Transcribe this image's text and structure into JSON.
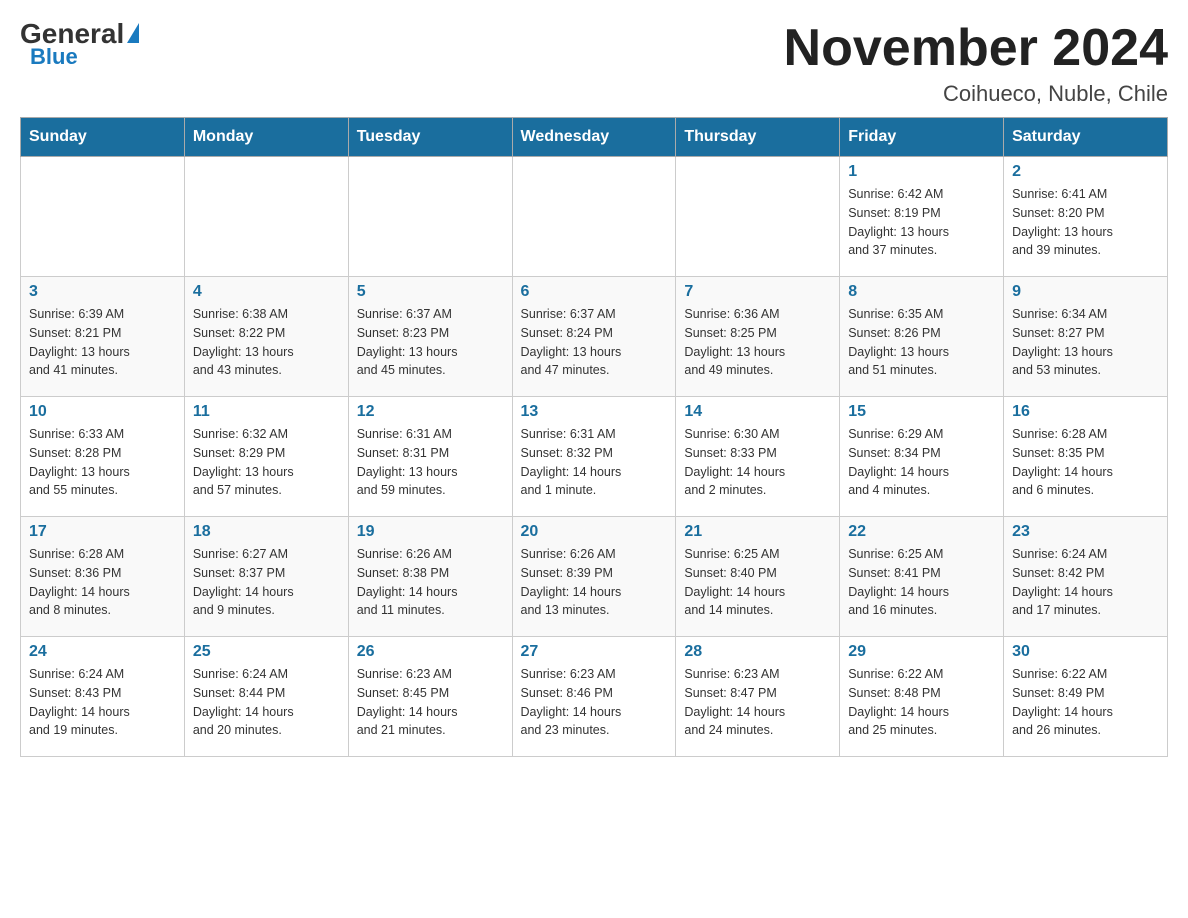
{
  "logo": {
    "general": "General",
    "blue": "Blue",
    "triangle_unicode": "▶"
  },
  "title": "November 2024",
  "location": "Coihueco, Nuble, Chile",
  "weekdays": [
    "Sunday",
    "Monday",
    "Tuesday",
    "Wednesday",
    "Thursday",
    "Friday",
    "Saturday"
  ],
  "weeks": [
    [
      {
        "day": "",
        "info": ""
      },
      {
        "day": "",
        "info": ""
      },
      {
        "day": "",
        "info": ""
      },
      {
        "day": "",
        "info": ""
      },
      {
        "day": "",
        "info": ""
      },
      {
        "day": "1",
        "info": "Sunrise: 6:42 AM\nSunset: 8:19 PM\nDaylight: 13 hours\nand 37 minutes."
      },
      {
        "day": "2",
        "info": "Sunrise: 6:41 AM\nSunset: 8:20 PM\nDaylight: 13 hours\nand 39 minutes."
      }
    ],
    [
      {
        "day": "3",
        "info": "Sunrise: 6:39 AM\nSunset: 8:21 PM\nDaylight: 13 hours\nand 41 minutes."
      },
      {
        "day": "4",
        "info": "Sunrise: 6:38 AM\nSunset: 8:22 PM\nDaylight: 13 hours\nand 43 minutes."
      },
      {
        "day": "5",
        "info": "Sunrise: 6:37 AM\nSunset: 8:23 PM\nDaylight: 13 hours\nand 45 minutes."
      },
      {
        "day": "6",
        "info": "Sunrise: 6:37 AM\nSunset: 8:24 PM\nDaylight: 13 hours\nand 47 minutes."
      },
      {
        "day": "7",
        "info": "Sunrise: 6:36 AM\nSunset: 8:25 PM\nDaylight: 13 hours\nand 49 minutes."
      },
      {
        "day": "8",
        "info": "Sunrise: 6:35 AM\nSunset: 8:26 PM\nDaylight: 13 hours\nand 51 minutes."
      },
      {
        "day": "9",
        "info": "Sunrise: 6:34 AM\nSunset: 8:27 PM\nDaylight: 13 hours\nand 53 minutes."
      }
    ],
    [
      {
        "day": "10",
        "info": "Sunrise: 6:33 AM\nSunset: 8:28 PM\nDaylight: 13 hours\nand 55 minutes."
      },
      {
        "day": "11",
        "info": "Sunrise: 6:32 AM\nSunset: 8:29 PM\nDaylight: 13 hours\nand 57 minutes."
      },
      {
        "day": "12",
        "info": "Sunrise: 6:31 AM\nSunset: 8:31 PM\nDaylight: 13 hours\nand 59 minutes."
      },
      {
        "day": "13",
        "info": "Sunrise: 6:31 AM\nSunset: 8:32 PM\nDaylight: 14 hours\nand 1 minute."
      },
      {
        "day": "14",
        "info": "Sunrise: 6:30 AM\nSunset: 8:33 PM\nDaylight: 14 hours\nand 2 minutes."
      },
      {
        "day": "15",
        "info": "Sunrise: 6:29 AM\nSunset: 8:34 PM\nDaylight: 14 hours\nand 4 minutes."
      },
      {
        "day": "16",
        "info": "Sunrise: 6:28 AM\nSunset: 8:35 PM\nDaylight: 14 hours\nand 6 minutes."
      }
    ],
    [
      {
        "day": "17",
        "info": "Sunrise: 6:28 AM\nSunset: 8:36 PM\nDaylight: 14 hours\nand 8 minutes."
      },
      {
        "day": "18",
        "info": "Sunrise: 6:27 AM\nSunset: 8:37 PM\nDaylight: 14 hours\nand 9 minutes."
      },
      {
        "day": "19",
        "info": "Sunrise: 6:26 AM\nSunset: 8:38 PM\nDaylight: 14 hours\nand 11 minutes."
      },
      {
        "day": "20",
        "info": "Sunrise: 6:26 AM\nSunset: 8:39 PM\nDaylight: 14 hours\nand 13 minutes."
      },
      {
        "day": "21",
        "info": "Sunrise: 6:25 AM\nSunset: 8:40 PM\nDaylight: 14 hours\nand 14 minutes."
      },
      {
        "day": "22",
        "info": "Sunrise: 6:25 AM\nSunset: 8:41 PM\nDaylight: 14 hours\nand 16 minutes."
      },
      {
        "day": "23",
        "info": "Sunrise: 6:24 AM\nSunset: 8:42 PM\nDaylight: 14 hours\nand 17 minutes."
      }
    ],
    [
      {
        "day": "24",
        "info": "Sunrise: 6:24 AM\nSunset: 8:43 PM\nDaylight: 14 hours\nand 19 minutes."
      },
      {
        "day": "25",
        "info": "Sunrise: 6:24 AM\nSunset: 8:44 PM\nDaylight: 14 hours\nand 20 minutes."
      },
      {
        "day": "26",
        "info": "Sunrise: 6:23 AM\nSunset: 8:45 PM\nDaylight: 14 hours\nand 21 minutes."
      },
      {
        "day": "27",
        "info": "Sunrise: 6:23 AM\nSunset: 8:46 PM\nDaylight: 14 hours\nand 23 minutes."
      },
      {
        "day": "28",
        "info": "Sunrise: 6:23 AM\nSunset: 8:47 PM\nDaylight: 14 hours\nand 24 minutes."
      },
      {
        "day": "29",
        "info": "Sunrise: 6:22 AM\nSunset: 8:48 PM\nDaylight: 14 hours\nand 25 minutes."
      },
      {
        "day": "30",
        "info": "Sunrise: 6:22 AM\nSunset: 8:49 PM\nDaylight: 14 hours\nand 26 minutes."
      }
    ]
  ]
}
